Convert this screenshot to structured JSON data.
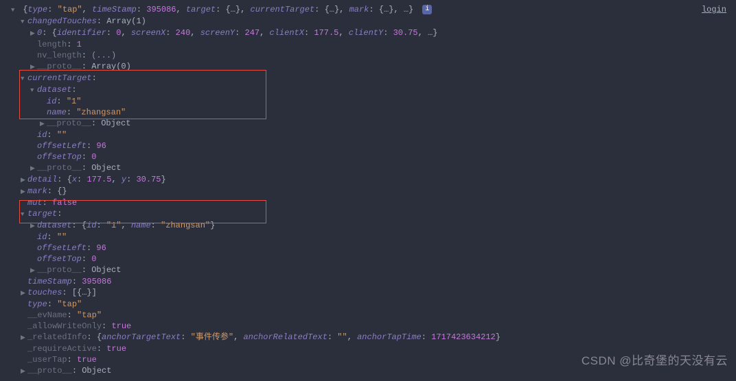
{
  "login": "login",
  "root": {
    "typeKey": "type",
    "typeVal": "\"tap\"",
    "timeStampKey": "timeStamp",
    "timeStampVal": "395086",
    "targetKey": "target",
    "targetVal": "{…}",
    "currentTargetKey": "currentTarget",
    "currentTargetVal": "{…}",
    "markKey": "mark",
    "markVal": "{…}",
    "ellipsis": "…"
  },
  "changedTouches": {
    "key": "changedTouches",
    "val": "Array(1)",
    "item0": {
      "idx": "0",
      "identifierKey": "identifier",
      "identifierVal": "0",
      "screenXKey": "screenX",
      "screenXVal": "240",
      "screenYKey": "screenY",
      "screenYVal": "247",
      "clientXKey": "clientX",
      "clientXVal": "177.5",
      "clientYKey": "clientY",
      "clientYVal": "30.75",
      "ellipsis": "…"
    },
    "lengthKey": "length",
    "lengthVal": "1",
    "nvLengthKey": "nv_length",
    "nvLengthVal": "(...)",
    "protoKey": "__proto__",
    "protoVal": "Array(0)"
  },
  "currentTarget": {
    "key": "currentTarget",
    "datasetKey": "dataset",
    "idKey": "id",
    "idVal": "\"1\"",
    "nameKey": "name",
    "nameVal": "\"zhangsan\"",
    "protoKey": "__proto__",
    "protoVal": "Object",
    "id2Key": "id",
    "id2Val": "\"\"",
    "offsetLeftKey": "offsetLeft",
    "offsetLeftVal": "96",
    "offsetTopKey": "offsetTop",
    "offsetTopVal": "0",
    "proto2Key": "__proto__",
    "proto2Val": "Object"
  },
  "detail": {
    "key": "detail",
    "xKey": "x",
    "xVal": "177.5",
    "yKey": "y",
    "yVal": "30.75"
  },
  "mark": {
    "key": "mark",
    "val": "{}"
  },
  "mut": {
    "key": "mut",
    "val": "false"
  },
  "target": {
    "key": "target",
    "datasetKey": "dataset",
    "idKey": "id",
    "idVal": "\"1\"",
    "nameKey": "name",
    "nameVal": "\"zhangsan\"",
    "id2Key": "id",
    "id2Val": "\"\"",
    "offsetLeftKey": "offsetLeft",
    "offsetLeftVal": "96",
    "offsetTopKey": "offsetTop",
    "offsetTopVal": "0",
    "protoKey": "__proto__",
    "protoVal": "Object"
  },
  "timeStamp": {
    "key": "timeStamp",
    "val": "395086"
  },
  "touches": {
    "key": "touches",
    "val": "[{…}]"
  },
  "type": {
    "key": "type",
    "val": "\"tap\""
  },
  "evName": {
    "key": "__evName",
    "val": "\"tap\""
  },
  "allowWriteOnly": {
    "key": "_allowWriteOnly",
    "val": "true"
  },
  "relatedInfo": {
    "key": "_relatedInfo",
    "anchorTargetTextKey": "anchorTargetText",
    "anchorTargetTextVal": "\"事件传参\"",
    "anchorRelatedTextKey": "anchorRelatedText",
    "anchorRelatedTextVal": "\"\"",
    "anchorTapTimeKey": "anchorTapTime",
    "anchorTapTimeVal": "1717423634212"
  },
  "requireActive": {
    "key": "_requireActive",
    "val": "true"
  },
  "userTap": {
    "key": "_userTap",
    "val": "true"
  },
  "proto": {
    "key": "__proto__",
    "val": "Object"
  },
  "watermark": "CSDN @比奇堡的天没有云",
  "infoBadge": "i"
}
